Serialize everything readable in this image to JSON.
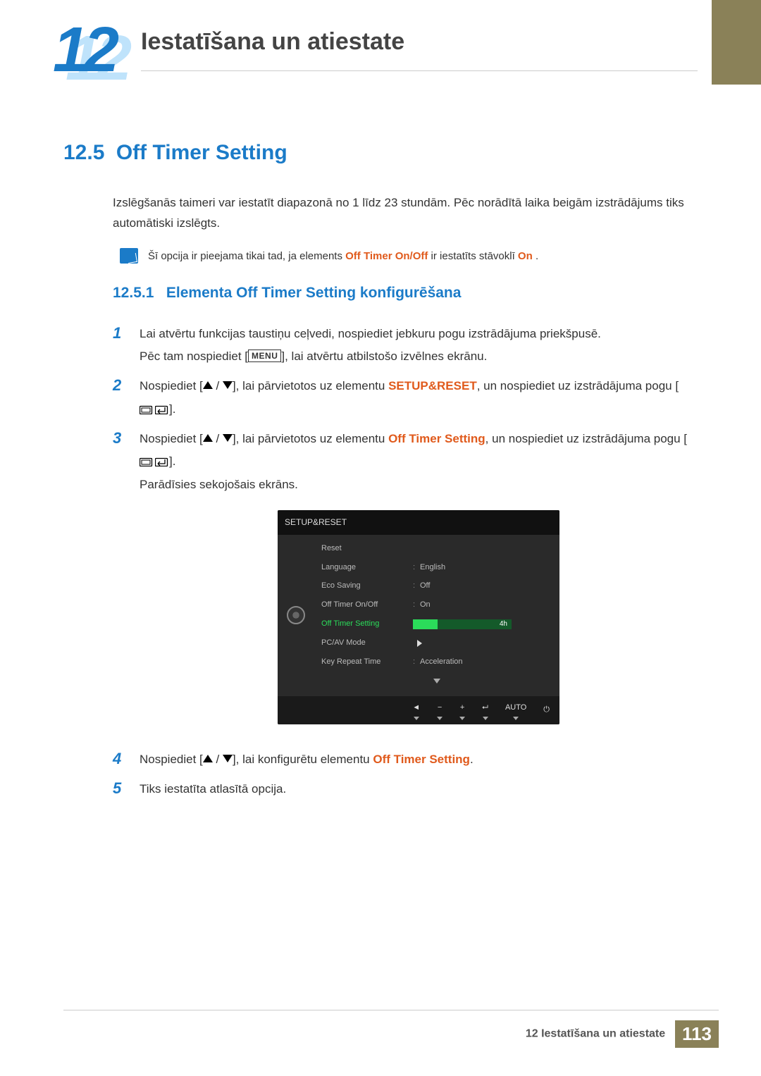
{
  "header": {
    "chapter_number": "12",
    "chapter_title": "Iestatīšana un atiestate"
  },
  "section": {
    "number": "12.5",
    "title": "Off Timer Setting",
    "intro": "Izslēgšanās taimeri var iestatīt diapazonā no 1 līdz 23 stundām. Pēc norādītā laika beigām izstrādājums tiks automātiski izslēgts."
  },
  "note": {
    "text_before": "Šī opcija ir pieejama tikai tad, ja elements ",
    "em1": "Off Timer On/Off",
    "text_mid": " ir iestatīts stāvoklī ",
    "em2": "On",
    "text_after": "."
  },
  "subsection": {
    "number": "12.5.1",
    "title": "Elementa Off Timer Setting konfigurēšana"
  },
  "steps": {
    "s1a": "Lai atvērtu funkcijas taustiņu ceļvedi, nospiediet jebkuru pogu izstrādājuma priekšpusē.",
    "s1b_before": "Pēc tam nospiediet [",
    "menu_label": "MENU",
    "s1b_after": "], lai atvērtu atbilstošo izvēlnes ekrānu.",
    "s2_before": "Nospiediet [",
    "s2_mid": "], lai pārvietotos uz elementu ",
    "s2_em": "SETUP&RESET",
    "s2_after": ", un nospiediet uz izstrādājuma pogu [",
    "s2_end": "].",
    "s3_before": "Nospiediet [",
    "s3_mid": "], lai pārvietotos uz elementu ",
    "s3_em": "Off Timer Setting",
    "s3_after": ", un nospiediet uz izstrādājuma pogu [",
    "s3_end": "].",
    "s3_note": "Parādīsies sekojošais ekrāns.",
    "s4_before": "Nospiediet [",
    "s4_mid": "], lai konfigurētu elementu ",
    "s4_em": "Off Timer Setting",
    "s4_after": ".",
    "s5": "Tiks iestatīta atlasītā opcija."
  },
  "osd": {
    "title": "SETUP&RESET",
    "rows": [
      {
        "label": "Reset",
        "value": ""
      },
      {
        "label": "Language",
        "value": "English"
      },
      {
        "label": "Eco Saving",
        "value": "Off"
      },
      {
        "label": "Off Timer On/Off",
        "value": "On"
      },
      {
        "label": "Off Timer Setting",
        "value": "4h",
        "selected": true,
        "bar": true
      },
      {
        "label": "PC/AV Mode",
        "value": ""
      },
      {
        "label": "Key Repeat Time",
        "value": "Acceleration"
      }
    ],
    "footer_auto": "AUTO"
  },
  "footer": {
    "text": "12 Iestatīšana un atiestate",
    "page": "113"
  }
}
